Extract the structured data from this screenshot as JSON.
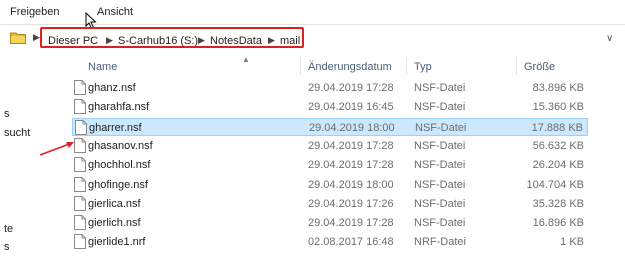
{
  "ribbon": {
    "tabs": [
      "Freigeben",
      "Ansicht"
    ]
  },
  "address": {
    "crumbs": [
      "Dieser PC",
      "S-Carhub16 (S:)",
      "NotesData",
      "mail"
    ]
  },
  "left_pane": {
    "fragments": [
      "s",
      "sucht",
      "te",
      "s"
    ]
  },
  "columns": {
    "name": "Name",
    "date": "Änderungsdatum",
    "type": "Typ",
    "size": "Größe"
  },
  "files": [
    {
      "name": "ghanz.nsf",
      "date": "29.04.2019 17:28",
      "type": "NSF-Datei",
      "size": "83.896 KB",
      "selected": false
    },
    {
      "name": "gharahfa.nsf",
      "date": "29.04.2019 16:45",
      "type": "NSF-Datei",
      "size": "15.360 KB",
      "selected": false
    },
    {
      "name": "gharrer.nsf",
      "date": "29.04.2019 18:00",
      "type": "NSF-Datei",
      "size": "17.888 KB",
      "selected": true
    },
    {
      "name": "ghasanov.nsf",
      "date": "29.04.2019 17:28",
      "type": "NSF-Datei",
      "size": "56.632 KB",
      "selected": false
    },
    {
      "name": "ghochhol.nsf",
      "date": "29.04.2019 17:28",
      "type": "NSF-Datei",
      "size": "26.204 KB",
      "selected": false
    },
    {
      "name": "ghofinge.nsf",
      "date": "29.04.2019 18:00",
      "type": "NSF-Datei",
      "size": "104.704 KB",
      "selected": false
    },
    {
      "name": "gierlica.nsf",
      "date": "29.04.2019 17:26",
      "type": "NSF-Datei",
      "size": "35.328 KB",
      "selected": false
    },
    {
      "name": "gierlich.nsf",
      "date": "29.04.2019 17:28",
      "type": "NSF-Datei",
      "size": "16.896 KB",
      "selected": false
    },
    {
      "name": "gierlide1.nrf",
      "date": "02.08.2017 16:48",
      "type": "NRF-Datei",
      "size": "1 KB",
      "selected": false
    }
  ],
  "colors": {
    "selection": "#cce8ff",
    "selection_border": "#99d1ff",
    "annotation": "#e02020",
    "header_text": "#4c607a"
  },
  "icons": {
    "folder": "folder-icon",
    "file": "file-icon",
    "cursor": "mouse-cursor-icon",
    "arrow": "red-arrow-annotation"
  }
}
